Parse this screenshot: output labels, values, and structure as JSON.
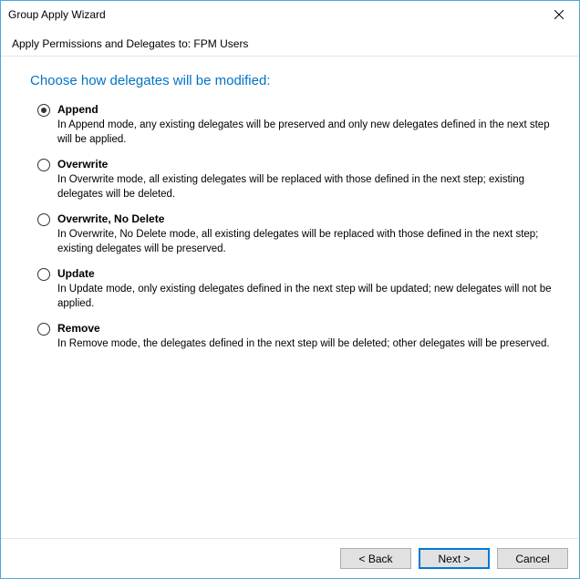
{
  "window": {
    "title": "Group Apply Wizard"
  },
  "subtitle": "Apply Permissions and Delegates to: FPM Users",
  "heading": "Choose how delegates will be modified:",
  "options": [
    {
      "label": "Append",
      "desc": "In Append mode, any existing delegates will be preserved and only new delegates defined in the next step will be applied.",
      "checked": true
    },
    {
      "label": "Overwrite",
      "desc": "In Overwrite mode, all existing delegates will be replaced with those defined in the next step; existing delegates will be deleted.",
      "checked": false
    },
    {
      "label": "Overwrite, No Delete",
      "desc": "In Overwrite, No Delete mode, all existing delegates will be replaced with those defined in the next step; existing delegates will be preserved.",
      "checked": false
    },
    {
      "label": "Update",
      "desc": "In Update mode, only existing delegates defined in the next step will be updated; new delegates will not be applied.",
      "checked": false
    },
    {
      "label": "Remove",
      "desc": "In Remove mode, the delegates defined in the next step will be deleted; other delegates will be preserved.",
      "checked": false
    }
  ],
  "buttons": {
    "back": "< Back",
    "next": "Next >",
    "cancel": "Cancel"
  }
}
